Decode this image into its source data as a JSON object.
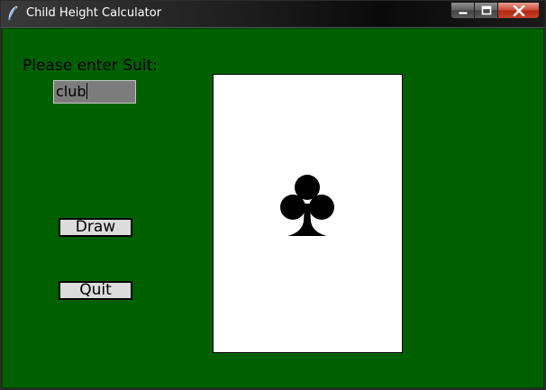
{
  "window": {
    "title": "Child Height Calculator",
    "icon": "feather-icon"
  },
  "caption_buttons": {
    "minimize_icon": "minimize-icon",
    "maximize_icon": "maximize-icon",
    "close_icon": "close-icon"
  },
  "form": {
    "prompt_label": "Please enter Suit:",
    "suit_value": "club",
    "draw_label": "Draw",
    "quit_label": "Quit"
  },
  "card": {
    "suit": "club",
    "suit_icon": "club-icon"
  },
  "colors": {
    "table_green": "#006000",
    "card_face": "#ffffff",
    "input_background": "#7c7c7c",
    "button_face": "#dcdcdc",
    "close_button": "#c8412a"
  }
}
